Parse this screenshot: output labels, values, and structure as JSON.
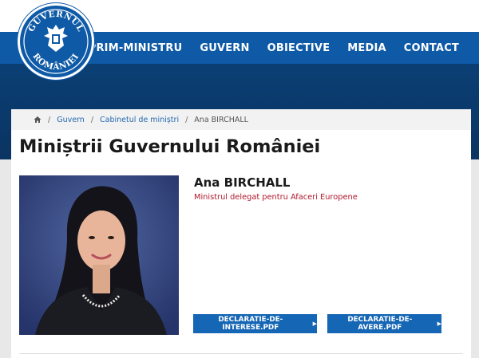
{
  "header": {
    "logo_top": "GUVERNUL",
    "logo_bottom": "ROMÂNIEI",
    "nav": [
      {
        "label": "PRIM-MINISTRU"
      },
      {
        "label": "GUVERN"
      },
      {
        "label": "OBIECTIVE"
      },
      {
        "label": "MEDIA"
      },
      {
        "label": "CONTACT"
      }
    ]
  },
  "breadcrumb": {
    "home_icon": "home-icon",
    "separator": "/",
    "items": [
      "Guvern",
      "Cabinetul de miniștri"
    ],
    "current": "Ana BIRCHALL"
  },
  "page": {
    "title": "Miniștrii Guvernului României"
  },
  "minister": {
    "name": "Ana BIRCHALL",
    "role": "Ministrul delegat pentru Afaceri Europene",
    "buttons": [
      {
        "label": "DECLARATIE-DE-INTERESE.PDF"
      },
      {
        "label": "DECLARATIE-DE-AVERE.PDF"
      }
    ]
  },
  "colors": {
    "nav_blue": "#0e5aa7",
    "dark_band": "#0b3f74",
    "button_blue": "#1566b5",
    "role_red": "#b0182c"
  }
}
